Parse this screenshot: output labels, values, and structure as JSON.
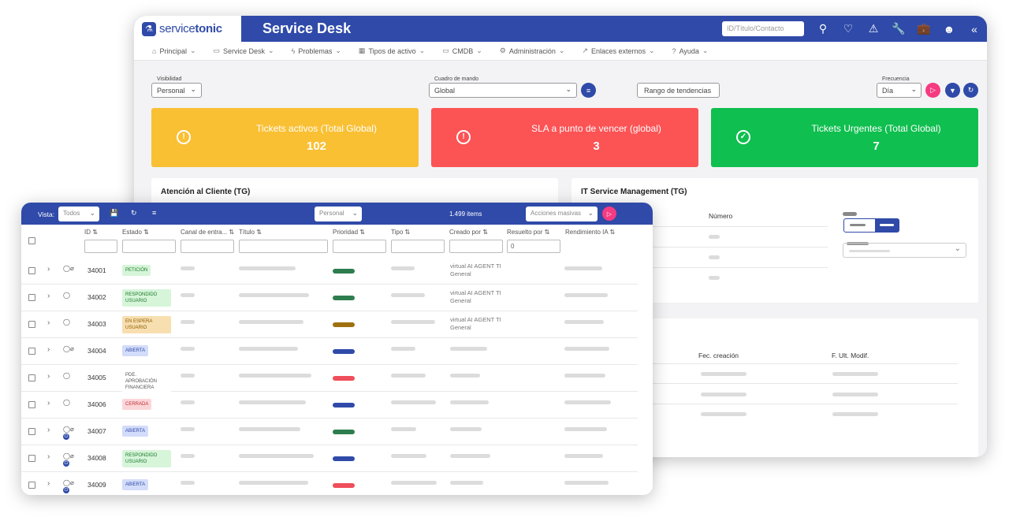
{
  "back": {
    "brand": {
      "service": "service",
      "tonic": "tonic"
    },
    "title": "Service Desk",
    "search_placeholder": "ID/Título/Contacto",
    "menu": [
      "Principal",
      "Service Desk",
      "Problemas",
      "Tipos de activo",
      "CMDB",
      "Administración",
      "Enlaces externos",
      "Ayuda"
    ],
    "filters": {
      "visibility_label": "Visibilidad",
      "visibility_value": "Personal",
      "dashboard_label": "Cuadro de mando",
      "dashboard_value": "Global",
      "trend_range": "Rango de tendencias",
      "frequency_label": "Frecuencia",
      "frequency_value": "Día"
    },
    "cards": [
      {
        "title": "Tickets activos (Total Global)",
        "value": "102",
        "color": "#f9c034"
      },
      {
        "title": "SLA a punto de vencer (global)",
        "value": "3",
        "color": "#fc5355"
      },
      {
        "title": "Tickets Urgentes (Total Global)",
        "value": "7",
        "color": "#0fbf4f"
      }
    ],
    "panel_left_title": "Atención al Cliente (TG)",
    "panel_right_title": "IT Service Management (TG)",
    "panel_right_col": "Número",
    "bottom_cols": [
      "Fec. creación",
      "F. Ult. Modif."
    ]
  },
  "front": {
    "vista_label": "Vista:",
    "vista_value": "Todos",
    "personal": "Personal",
    "items": "1.499 items",
    "bulk": "Acciones masivas",
    "columns": [
      "ID",
      "Estado",
      "Canal de entra...",
      "Título",
      "Prioridad",
      "Tipo",
      "Creado por",
      "Resuelto por",
      "Rendimiento IA"
    ],
    "resolved_filter": "0",
    "rows": [
      {
        "id": "34001",
        "status": "PETICIÓN",
        "st_bg": "#d6f5d9",
        "st_fg": "#1e7a2e",
        "prio": "#2e7d4f",
        "creator": "virtual AI AGENT TI General",
        "clip": true,
        "ci": false
      },
      {
        "id": "34002",
        "status": "RESPONDIDO USUARIO",
        "st_bg": "#d6f5d9",
        "st_fg": "#1e7a2e",
        "prio": "#2e7d4f",
        "creator": "virtual AI AGENT TI General",
        "clip": false,
        "ci": false
      },
      {
        "id": "34003",
        "status": "EN ESPERA USUARIO",
        "st_bg": "#f8dfb0",
        "st_fg": "#8a5a00",
        "prio": "#a07010",
        "creator": "virtual AI AGENT TI General",
        "clip": false,
        "ci": false
      },
      {
        "id": "34004",
        "status": "ABIERTA",
        "st_bg": "#d3dcfa",
        "st_fg": "#2f4aa8",
        "prio": "#2f4aa8",
        "creator": "",
        "clip": true,
        "ci": false
      },
      {
        "id": "34005",
        "status": "PDE. APROBACIÓN FINANCIERA",
        "st_bg": "#ffffff",
        "st_fg": "#555",
        "prio": "#ef4f5a",
        "creator": "",
        "clip": false,
        "ci": false
      },
      {
        "id": "34006",
        "status": "CERRADA",
        "st_bg": "#fbd6d8",
        "st_fg": "#c0303a",
        "prio": "#2f4aa8",
        "creator": "",
        "clip": false,
        "ci": false
      },
      {
        "id": "34007",
        "status": "ABIERTA",
        "st_bg": "#d3dcfa",
        "st_fg": "#2f4aa8",
        "prio": "#2e7d4f",
        "creator": "",
        "clip": true,
        "ci": true
      },
      {
        "id": "34008",
        "status": "RESPONDIDO USUARIO",
        "st_bg": "#d6f5d9",
        "st_fg": "#1e7a2e",
        "prio": "#2f4aa8",
        "creator": "",
        "clip": true,
        "ci": true
      },
      {
        "id": "34009",
        "status": "ABIERTA",
        "st_bg": "#d3dcfa",
        "st_fg": "#2f4aa8",
        "prio": "#ef4f5a",
        "creator": "",
        "clip": true,
        "ci": true
      }
    ]
  }
}
